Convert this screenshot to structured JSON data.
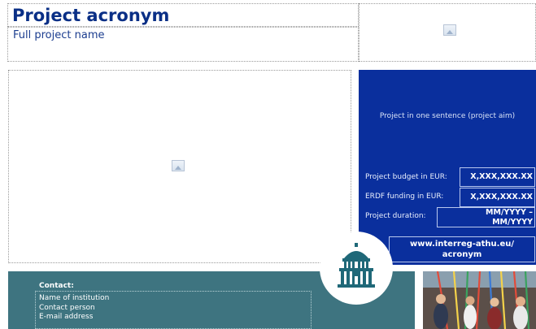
{
  "header": {
    "acronym": "Project acronym",
    "full_name": "Full project name"
  },
  "info": {
    "aim": "Project in one sentence (project aim)",
    "budget_label": "Project budget in EUR:",
    "budget_value": "X,XXX,XXX.XX",
    "erdf_label": "ERDF funding in EUR:",
    "erdf_value": "X,XXX,XXX.XX",
    "duration_label": "Project duration:",
    "duration_from": "MM/YYYY –",
    "duration_to": "MM/YYYY",
    "website_line1": "www.interreg-athu.eu/",
    "website_line2": "acronym"
  },
  "contact": {
    "title": "Contact:",
    "institution": "Name of institution",
    "person": "Contact person",
    "email": "E-mail address"
  },
  "colors": {
    "brand_blue": "#0a2f9d",
    "teal": "#3e7480",
    "emblem_teal": "#1f6878"
  },
  "icons": [
    "logo-placeholder-icon",
    "image-placeholder-icon",
    "building-emblem-icon"
  ]
}
